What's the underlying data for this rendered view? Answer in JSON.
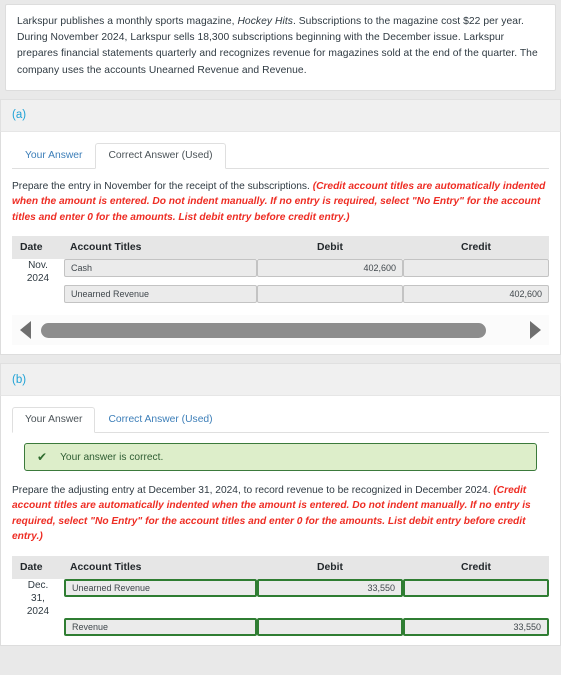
{
  "problem": {
    "text_before_italic": "Larkspur publishes a monthly sports magazine, ",
    "italic_title": "Hockey Hits",
    "text_after_italic": ". Subscriptions to the magazine cost $22 per year. During November 2024, Larkspur sells 18,300 subscriptions beginning with the December issue. Larkspur prepares financial statements quarterly and recognizes revenue for magazines sold at the end of the quarter. The company uses the accounts Unearned Revenue and Revenue."
  },
  "colors": {
    "part_label": "#1fa2d6",
    "tab_link": "#3c7eb8",
    "instruction_red": "#ee2d24",
    "success_border": "#3b7a3b",
    "success_bg": "#ddeeca",
    "field_green_border": "#2f7d32",
    "table_header_bg": "#e6e6e6"
  },
  "parts": [
    {
      "label": "(a)",
      "tabs": [
        {
          "label": "Your Answer",
          "active": false
        },
        {
          "label": "Correct Answer (Used)",
          "active": true
        }
      ],
      "instruction_plain": "Prepare the entry in November for the receipt of the subscriptions. ",
      "instruction_red": "(Credit account titles are automatically indented when the amount is entered. Do not indent manually. If no entry is required, select \"No Entry\" for the account titles and enter 0 for the amounts. List debit entry before credit entry.)",
      "alert": null,
      "table": {
        "headers": [
          "Date",
          "Account Titles",
          "Debit",
          "Credit"
        ],
        "rows": [
          {
            "date": [
              "Nov.",
              "2024"
            ],
            "account": "Cash",
            "debit": "402,600",
            "credit": "",
            "indent": false,
            "green": false
          },
          {
            "date": [
              "",
              ""
            ],
            "account": "Unearned Revenue",
            "debit": "",
            "credit": "402,600",
            "indent": true,
            "green": false
          }
        ]
      },
      "scrollbar": {
        "left_arrow": "scroll-left",
        "right_arrow": "scroll-right",
        "thumb_width_pct": 93
      }
    },
    {
      "label": "(b)",
      "tabs": [
        {
          "label": "Your Answer",
          "active": true
        },
        {
          "label": "Correct Answer (Used)",
          "active": false
        }
      ],
      "instruction_plain": "Prepare the adjusting entry at December 31, 2024, to record revenue to be recognized in December 2024. ",
      "instruction_red": "(Credit account titles are automatically indented when the amount is entered. Do not indent manually. If no entry is required, select \"No Entry\" for the account titles and enter 0 for the amounts. List debit entry before credit entry.)",
      "alert": {
        "icon": "check-icon",
        "message": "Your answer is correct."
      },
      "table": {
        "headers": [
          "Date",
          "Account Titles",
          "Debit",
          "Credit"
        ],
        "rows": [
          {
            "date": [
              "Dec.",
              "31,",
              "2024"
            ],
            "account": "Unearned Revenue",
            "debit": "33,550",
            "credit": "",
            "indent": false,
            "green": true
          },
          {
            "date": [
              "",
              "",
              ""
            ],
            "account": "Revenue",
            "debit": "",
            "credit": "33,550",
            "indent": true,
            "green": true
          }
        ]
      },
      "scrollbar": null
    }
  ]
}
